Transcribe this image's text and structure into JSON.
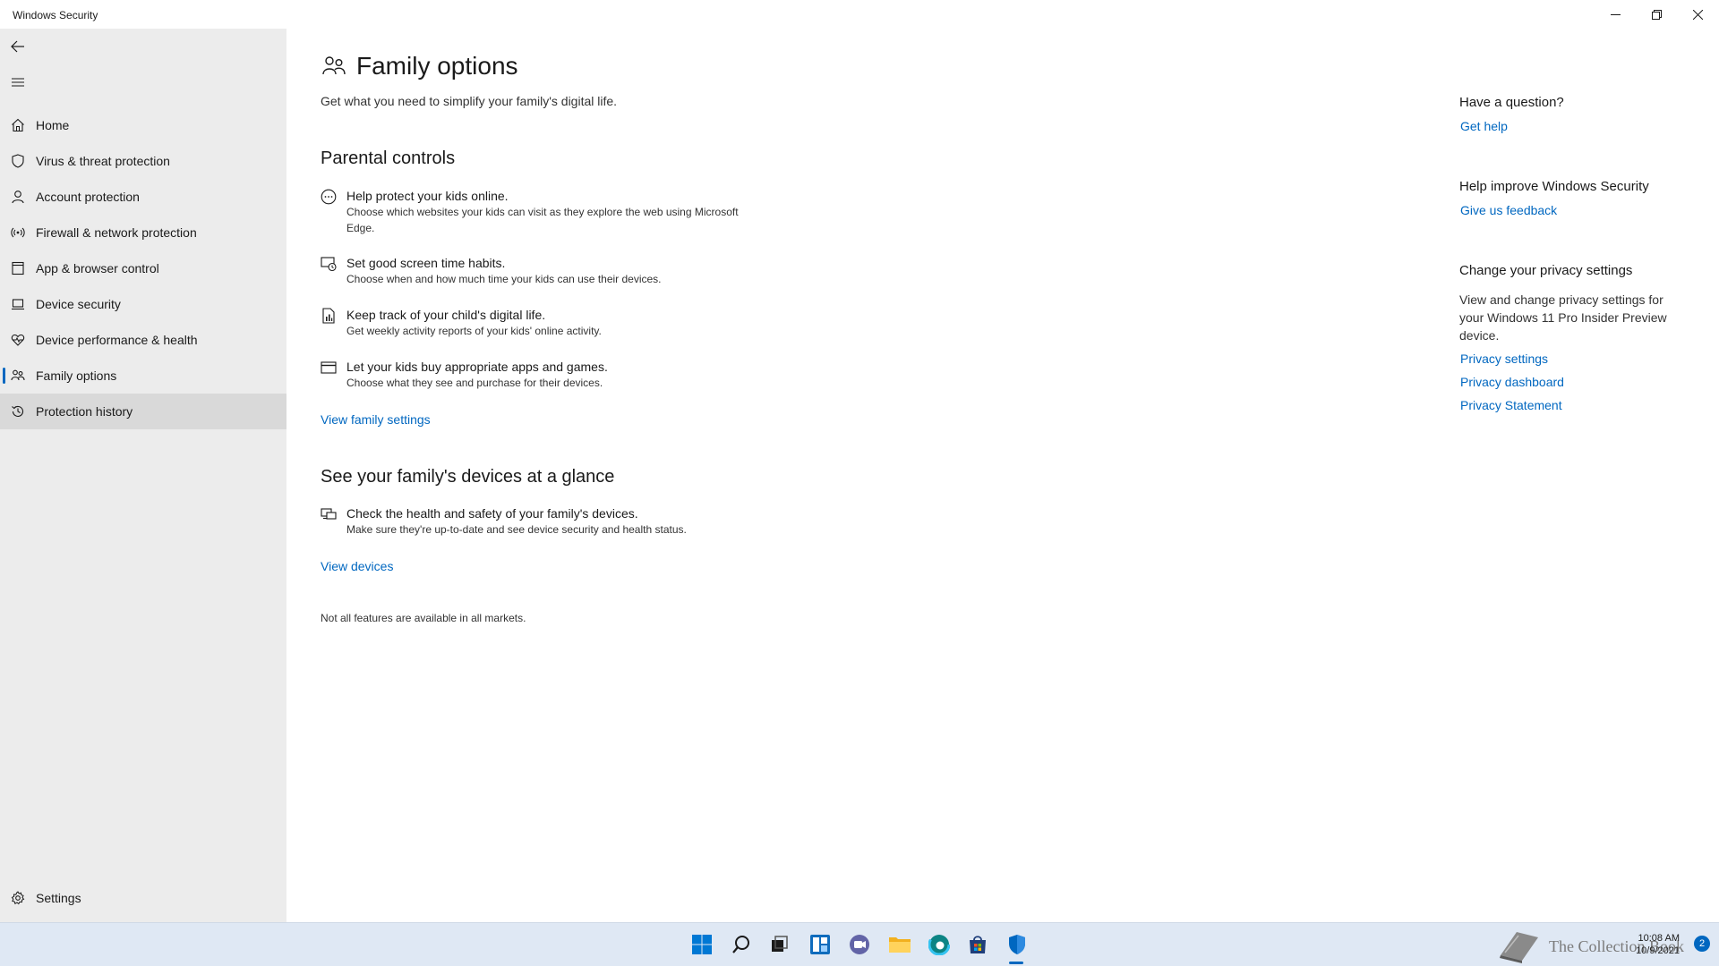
{
  "window": {
    "title": "Windows Security"
  },
  "sidebar": {
    "items": [
      {
        "label": "Home",
        "icon": "home-icon"
      },
      {
        "label": "Virus & threat protection",
        "icon": "shield-icon"
      },
      {
        "label": "Account protection",
        "icon": "person-icon"
      },
      {
        "label": "Firewall & network protection",
        "icon": "antenna-icon"
      },
      {
        "label": "App & browser control",
        "icon": "app-window-icon"
      },
      {
        "label": "Device security",
        "icon": "laptop-icon"
      },
      {
        "label": "Device performance & health",
        "icon": "heart-pulse-icon"
      },
      {
        "label": "Family options",
        "icon": "family-icon"
      },
      {
        "label": "Protection history",
        "icon": "history-icon"
      }
    ],
    "selected": "Family options",
    "settings_label": "Settings"
  },
  "main": {
    "title": "Family options",
    "subtitle": "Get what you need to simplify your family's digital life.",
    "parental": {
      "heading": "Parental controls",
      "features": [
        {
          "title": "Help protect your kids online.",
          "desc": "Choose which websites your kids can visit as they explore the web using Microsoft Edge.",
          "icon": "globe-chat-icon"
        },
        {
          "title": "Set good screen time habits.",
          "desc": "Choose when and how much time your kids can use their devices.",
          "icon": "screen-clock-icon"
        },
        {
          "title": "Keep track of your child's digital life.",
          "desc": "Get weekly activity reports of your kids' online activity.",
          "icon": "report-icon"
        },
        {
          "title": "Let your kids buy appropriate apps and games.",
          "desc": "Choose what they see and purchase for their devices.",
          "icon": "credit-card-icon"
        }
      ],
      "link": "View family settings"
    },
    "devices": {
      "heading": "See your family's devices at a glance",
      "feature": {
        "title": "Check the health and safety of your family's devices.",
        "desc": "Make sure they're up-to-date and see device security and health status.",
        "icon": "devices-icon"
      },
      "link": "View devices"
    },
    "note": "Not all features are available in all markets."
  },
  "right": {
    "question_heading": "Have a question?",
    "get_help": "Get help",
    "improve_heading": "Help improve Windows Security",
    "feedback": "Give us feedback",
    "privacy_heading": "Change your privacy settings",
    "privacy_text": "View and change privacy settings for your Windows 11 Pro Insider Preview device.",
    "privacy_settings": "Privacy settings",
    "privacy_dashboard": "Privacy dashboard",
    "privacy_statement": "Privacy Statement"
  },
  "taskbar": {
    "apps": [
      "start-icon",
      "search-icon",
      "task-view-icon",
      "widgets-icon",
      "chat-icon",
      "file-explorer-icon",
      "edge-icon",
      "store-icon",
      "windows-security-icon"
    ],
    "watermark": "The Collection Book",
    "time": "10:08 AM",
    "date": "10/9/2021",
    "notification_count": "2"
  },
  "colors": {
    "accent": "#0067c0",
    "sidebar_bg": "#ececec",
    "taskbar_bg": "#dfe8f4"
  }
}
